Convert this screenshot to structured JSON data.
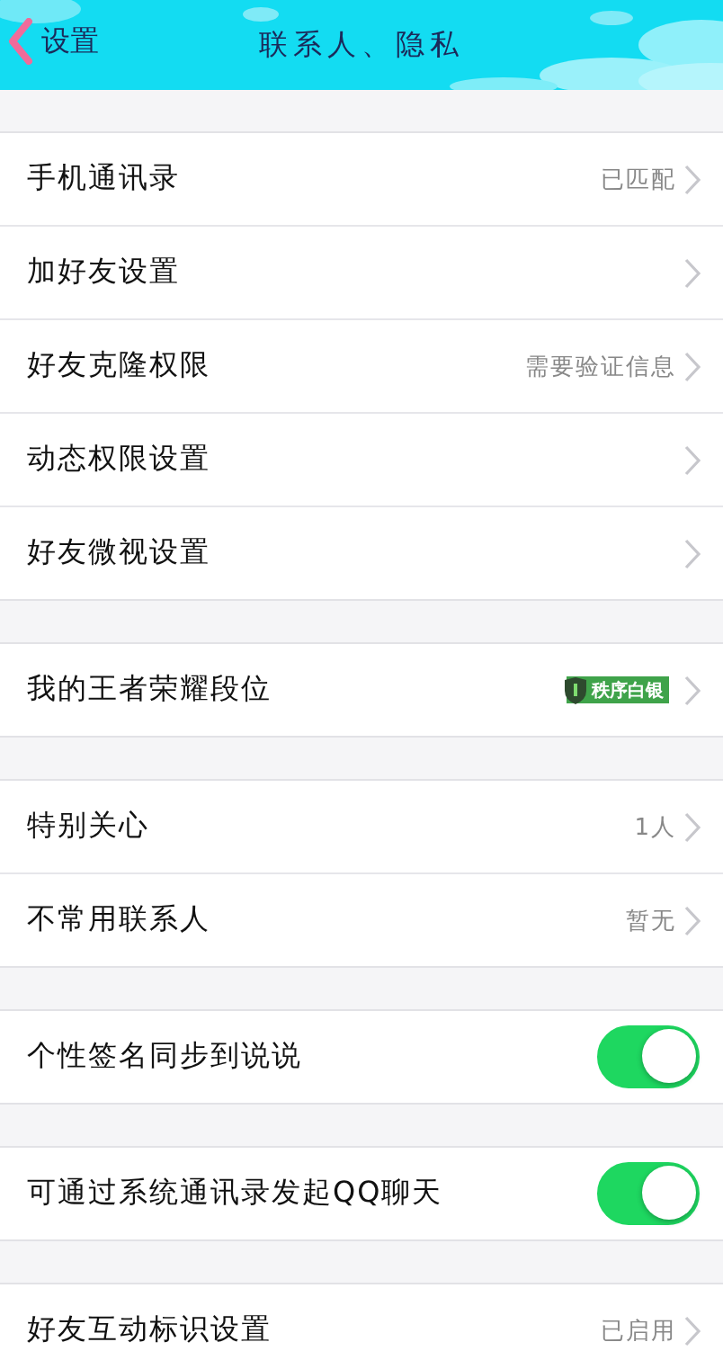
{
  "nav": {
    "back_label": "设置",
    "title": "联系人、隐私"
  },
  "groups": [
    {
      "items": [
        {
          "kind": "link",
          "label": "手机通讯录",
          "value": "已匹配"
        },
        {
          "kind": "link",
          "label": "加好友设置"
        },
        {
          "kind": "link",
          "label": "好友克隆权限",
          "value": "需要验证信息"
        },
        {
          "kind": "link",
          "label": "动态权限设置"
        },
        {
          "kind": "link",
          "label": "好友微视设置"
        }
      ]
    },
    {
      "items": [
        {
          "kind": "link",
          "label": "我的王者荣耀段位",
          "badge": "秩序白银"
        }
      ]
    },
    {
      "items": [
        {
          "kind": "link",
          "label": "特别关心",
          "value": "1人"
        },
        {
          "kind": "link",
          "label": "不常用联系人",
          "value": "暂无"
        }
      ]
    },
    {
      "items": [
        {
          "kind": "toggle",
          "label": "个性签名同步到说说",
          "on": true
        }
      ]
    },
    {
      "items": [
        {
          "kind": "toggle",
          "label": "可通过系统通讯录发起QQ聊天",
          "on": true
        }
      ]
    },
    {
      "items": [
        {
          "kind": "link",
          "label": "好友互动标识设置",
          "value": "已启用"
        }
      ]
    }
  ]
}
